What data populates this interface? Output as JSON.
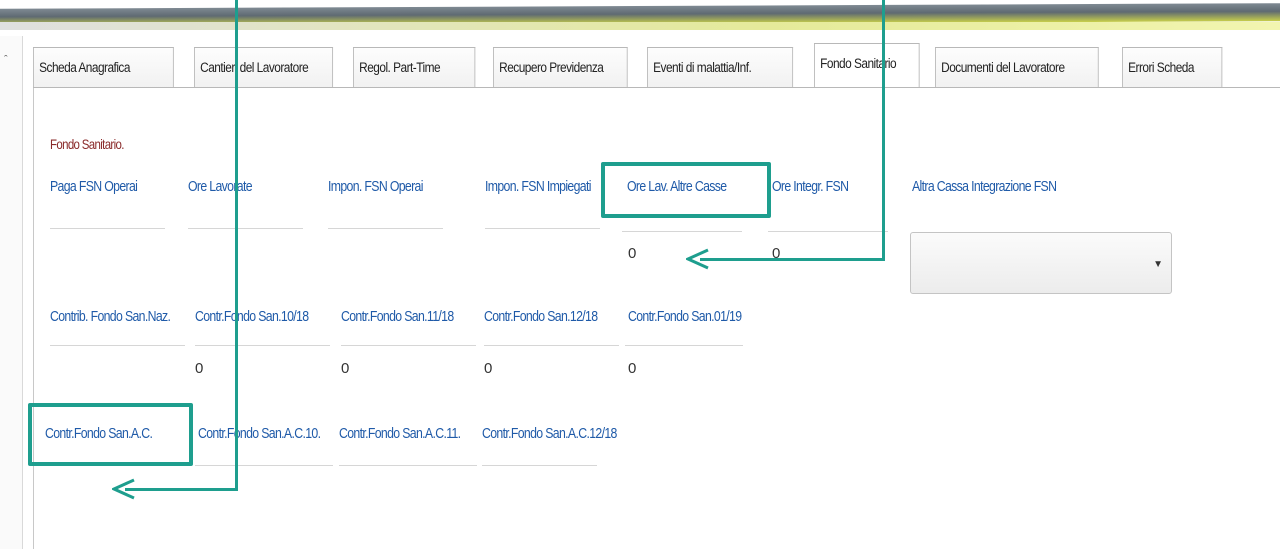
{
  "tabs": [
    {
      "label": "Scheda Anagrafica",
      "active": false
    },
    {
      "label": "Cantieri del Lavoratore",
      "active": false
    },
    {
      "label": "Regol. Part-Time",
      "active": false
    },
    {
      "label": "Recupero Previdenza",
      "active": false
    },
    {
      "label": "Eventi di malattia/Inf.",
      "active": false
    },
    {
      "label": "Fondo Sanitario",
      "active": true
    },
    {
      "label": "Documenti del Lavoratore",
      "active": false
    },
    {
      "label": "Errori Scheda",
      "active": false
    }
  ],
  "section_title": "Fondo Sanitario.",
  "row1": {
    "labels": [
      "Paga FSN Operai",
      "Ore Lavorate",
      "Impon. FSN Operai",
      "Impon. FSN Impiegati",
      "Ore Lav. Altre Casse",
      "Ore Integr. FSN"
    ],
    "values": [
      "0",
      "0"
    ],
    "select_label": "Altra Cassa Integrazione FSN",
    "select_value": ""
  },
  "row2": {
    "labels": [
      "Contrib. Fondo San.Naz.",
      "Contr.Fondo San.10/18",
      "Contr.Fondo San.11/18",
      "Contr.Fondo San.12/18",
      "Contr.Fondo San.01/19"
    ],
    "values": [
      "0",
      "0",
      "0",
      "0"
    ]
  },
  "row3": {
    "labels": [
      "Contr.Fondo San.A.C.",
      "Contr.Fondo San.A.C.10.",
      "Contr.Fondo San.A.C.11.",
      "Contr.Fondo San.A.C.12/18"
    ]
  },
  "colors": {
    "annotation": "#1e9e8e",
    "label": "#1f5aa8",
    "section": "#8a2a2a"
  },
  "icons": {
    "gutter": "caret-up-icon",
    "select_arrow": "triangle-down-icon"
  }
}
